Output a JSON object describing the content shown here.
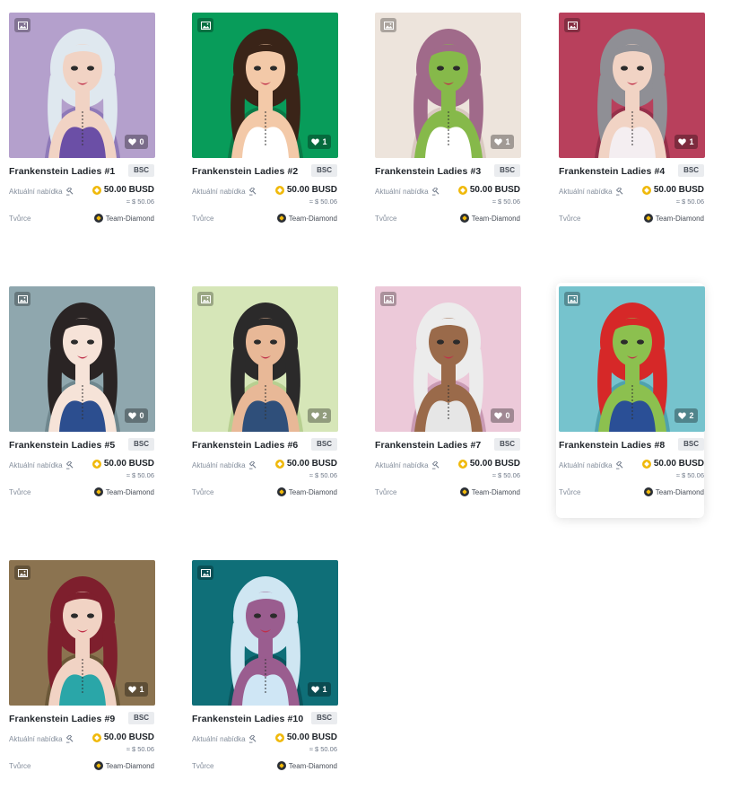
{
  "labels": {
    "offer": "Aktuální nabídka",
    "creator": "Tvůrce",
    "approx_prefix": "≈ $"
  },
  "icons": {
    "media": "image-icon",
    "like": "heart-icon",
    "offer": "auction-hammer-icon",
    "coin": "busd-coin-icon",
    "creator": "team-diamond-avatar"
  },
  "colors": {
    "accent": "#f0b90b",
    "text": "#1e2329",
    "muted": "#848e9c"
  },
  "items": [
    {
      "title": "Frankenstein Ladies #1",
      "chain": "BSC",
      "likes": "0",
      "price": "50.00 BUSD",
      "fiat": "≈ $ 50.06",
      "creator": "Team-Diamond",
      "bg": "#b4a0cc",
      "hair": "#dfe8ef",
      "skin": "#f1d3c4",
      "outfit": "#6b4fa6",
      "shadow": "#8e79b8"
    },
    {
      "title": "Frankenstein Ladies #2",
      "chain": "BSC",
      "likes": "1",
      "price": "50.00 BUSD",
      "fiat": "≈ $ 50.06",
      "creator": "Team-Diamond",
      "bg": "#089c5a",
      "hair": "#3a2418",
      "skin": "#f3c9a8",
      "outfit": "#ffffff",
      "shadow": "#0b7a47"
    },
    {
      "title": "Frankenstein Ladies #3",
      "chain": "BSC",
      "likes": "1",
      "price": "50.00 BUSD",
      "fiat": "≈ $ 50.06",
      "creator": "Team-Diamond",
      "bg": "#ede4dc",
      "hair": "#a06a8a",
      "skin": "#86b94a",
      "outfit": "#ffffff",
      "shadow": "#d9c8c0"
    },
    {
      "title": "Frankenstein Ladies #4",
      "chain": "BSC",
      "likes": "1",
      "price": "50.00 BUSD",
      "fiat": "≈ $ 50.06",
      "creator": "Team-Diamond",
      "bg": "#b8405c",
      "hair": "#8f8f95",
      "skin": "#f1d3c4",
      "outfit": "#f4eef1",
      "shadow": "#95304a"
    },
    {
      "title": "Frankenstein Ladies #5",
      "chain": "BSC",
      "likes": "0",
      "price": "50.00 BUSD",
      "fiat": "≈ $ 50.06",
      "creator": "Team-Diamond",
      "bg": "#8fa7ae",
      "hair": "#2a2424",
      "skin": "#f6e3d8",
      "outfit": "#2c4e8f",
      "shadow": "#6f878e"
    },
    {
      "title": "Frankenstein Ladies #6",
      "chain": "BSC",
      "likes": "2",
      "price": "50.00 BUSD",
      "fiat": "≈ $ 50.06",
      "creator": "Team-Diamond",
      "bg": "#d6e6b8",
      "hair": "#2b2a2a",
      "skin": "#e8b897",
      "outfit": "#2f4f7a",
      "shadow": "#b7cf90"
    },
    {
      "title": "Frankenstein Ladies #7",
      "chain": "BSC",
      "likes": "0",
      "price": "50.00 BUSD",
      "fiat": "≈ $ 50.06",
      "creator": "Team-Diamond",
      "bg": "#ecc9d9",
      "hair": "#ececec",
      "skin": "#9a6a4a",
      "outfit": "#e6e6e6",
      "shadow": "#c99ab3"
    },
    {
      "title": "Frankenstein Ladies #8",
      "chain": "BSC",
      "likes": "2",
      "price": "50.00 BUSD",
      "fiat": "≈ $ 50.06",
      "creator": "Team-Diamond",
      "bg": "#76c3cd",
      "hair": "#d62828",
      "skin": "#8cc04f",
      "outfit": "#2a4f96",
      "shadow": "#4fa2ae"
    },
    {
      "title": "Frankenstein Ladies #9",
      "chain": "BSC",
      "likes": "1",
      "price": "50.00 BUSD",
      "fiat": "≈ $ 50.06",
      "creator": "Team-Diamond",
      "bg": "#8b7350",
      "hair": "#7e1f2d",
      "skin": "#f1d3c4",
      "outfit": "#2aa6a8",
      "shadow": "#6b5838"
    },
    {
      "title": "Frankenstein Ladies #10",
      "chain": "BSC",
      "likes": "1",
      "price": "50.00 BUSD",
      "fiat": "≈ $ 50.06",
      "creator": "Team-Diamond",
      "bg": "#0f6f78",
      "hair": "#cfe6f2",
      "skin": "#9a5d8f",
      "outfit": "#cfe6f5",
      "shadow": "#0a555d"
    }
  ]
}
